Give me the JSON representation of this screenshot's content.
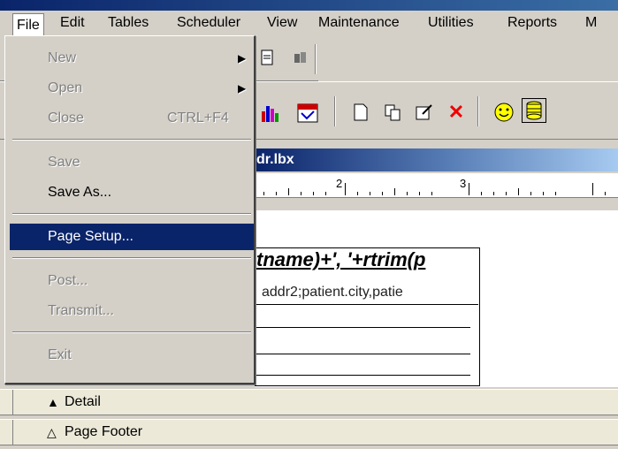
{
  "window": {
    "doc_title_partial": "dr.lbx"
  },
  "menubar": {
    "items": [
      "File",
      "Edit",
      "Tables",
      "Scheduler",
      "View",
      "Maintenance",
      "Utilities",
      "Reports",
      "M"
    ]
  },
  "file_menu": {
    "new": "New",
    "open": "Open",
    "close": "Close",
    "close_shortcut": "CTRL+F4",
    "save": "Save",
    "save_as": "Save As...",
    "page_setup": "Page Setup...",
    "post": "Post...",
    "transmit": "Transmit...",
    "exit": "Exit"
  },
  "ruler": {
    "marks": [
      "2",
      "3"
    ]
  },
  "report": {
    "expression": "tname)+', '+rtrim(p",
    "address_fields": "addr2;patient.city,patie"
  },
  "bands": {
    "detail": "Detail",
    "page_footer": "Page Footer"
  },
  "toolbar": {
    "icons": [
      "print-preview-icon",
      "chart-icon",
      "calendar-icon",
      "new-page-icon",
      "copy-icon",
      "edit-icon",
      "delete-icon",
      "smiley-icon",
      "database-icon"
    ]
  }
}
